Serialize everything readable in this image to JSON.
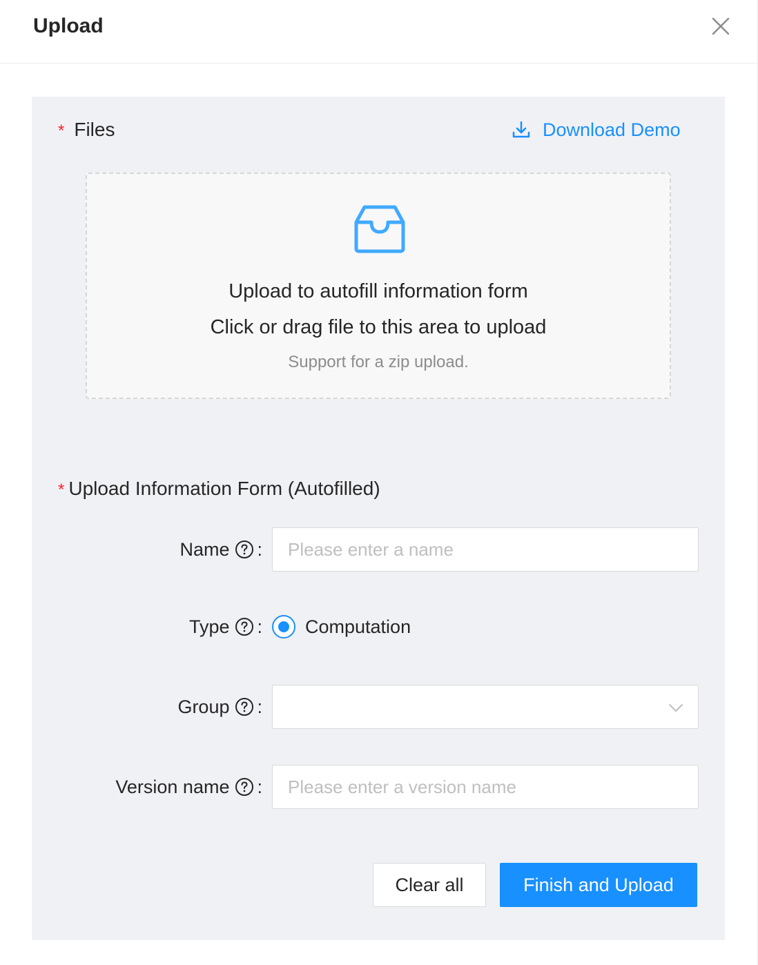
{
  "modal": {
    "title": "Upload",
    "close_icon": "close-icon"
  },
  "files": {
    "required_mark": "*",
    "label": "Files",
    "download_link": "Download Demo",
    "download_icon": "download-icon"
  },
  "dropzone": {
    "icon": "inbox-icon",
    "line1": "Upload to autofill information form",
    "line2": "Click or drag file to this area to upload",
    "hint": "Support for a zip upload."
  },
  "form": {
    "required_mark": "*",
    "section_label": "Upload Information Form (Autofilled)",
    "colon": ":",
    "name": {
      "label": "Name",
      "value": "",
      "placeholder": "Please enter a name"
    },
    "type": {
      "label": "Type",
      "option": "Computation",
      "selected": true
    },
    "group": {
      "label": "Group",
      "value": ""
    },
    "version": {
      "label": "Version name",
      "value": "",
      "placeholder": "Please enter a version name"
    }
  },
  "actions": {
    "clear_label": "Clear all",
    "submit_label": "Finish and Upload"
  },
  "colors": {
    "primary": "#1890ff",
    "required": "#f5222d",
    "panel_bg": "#f0f1f5"
  }
}
